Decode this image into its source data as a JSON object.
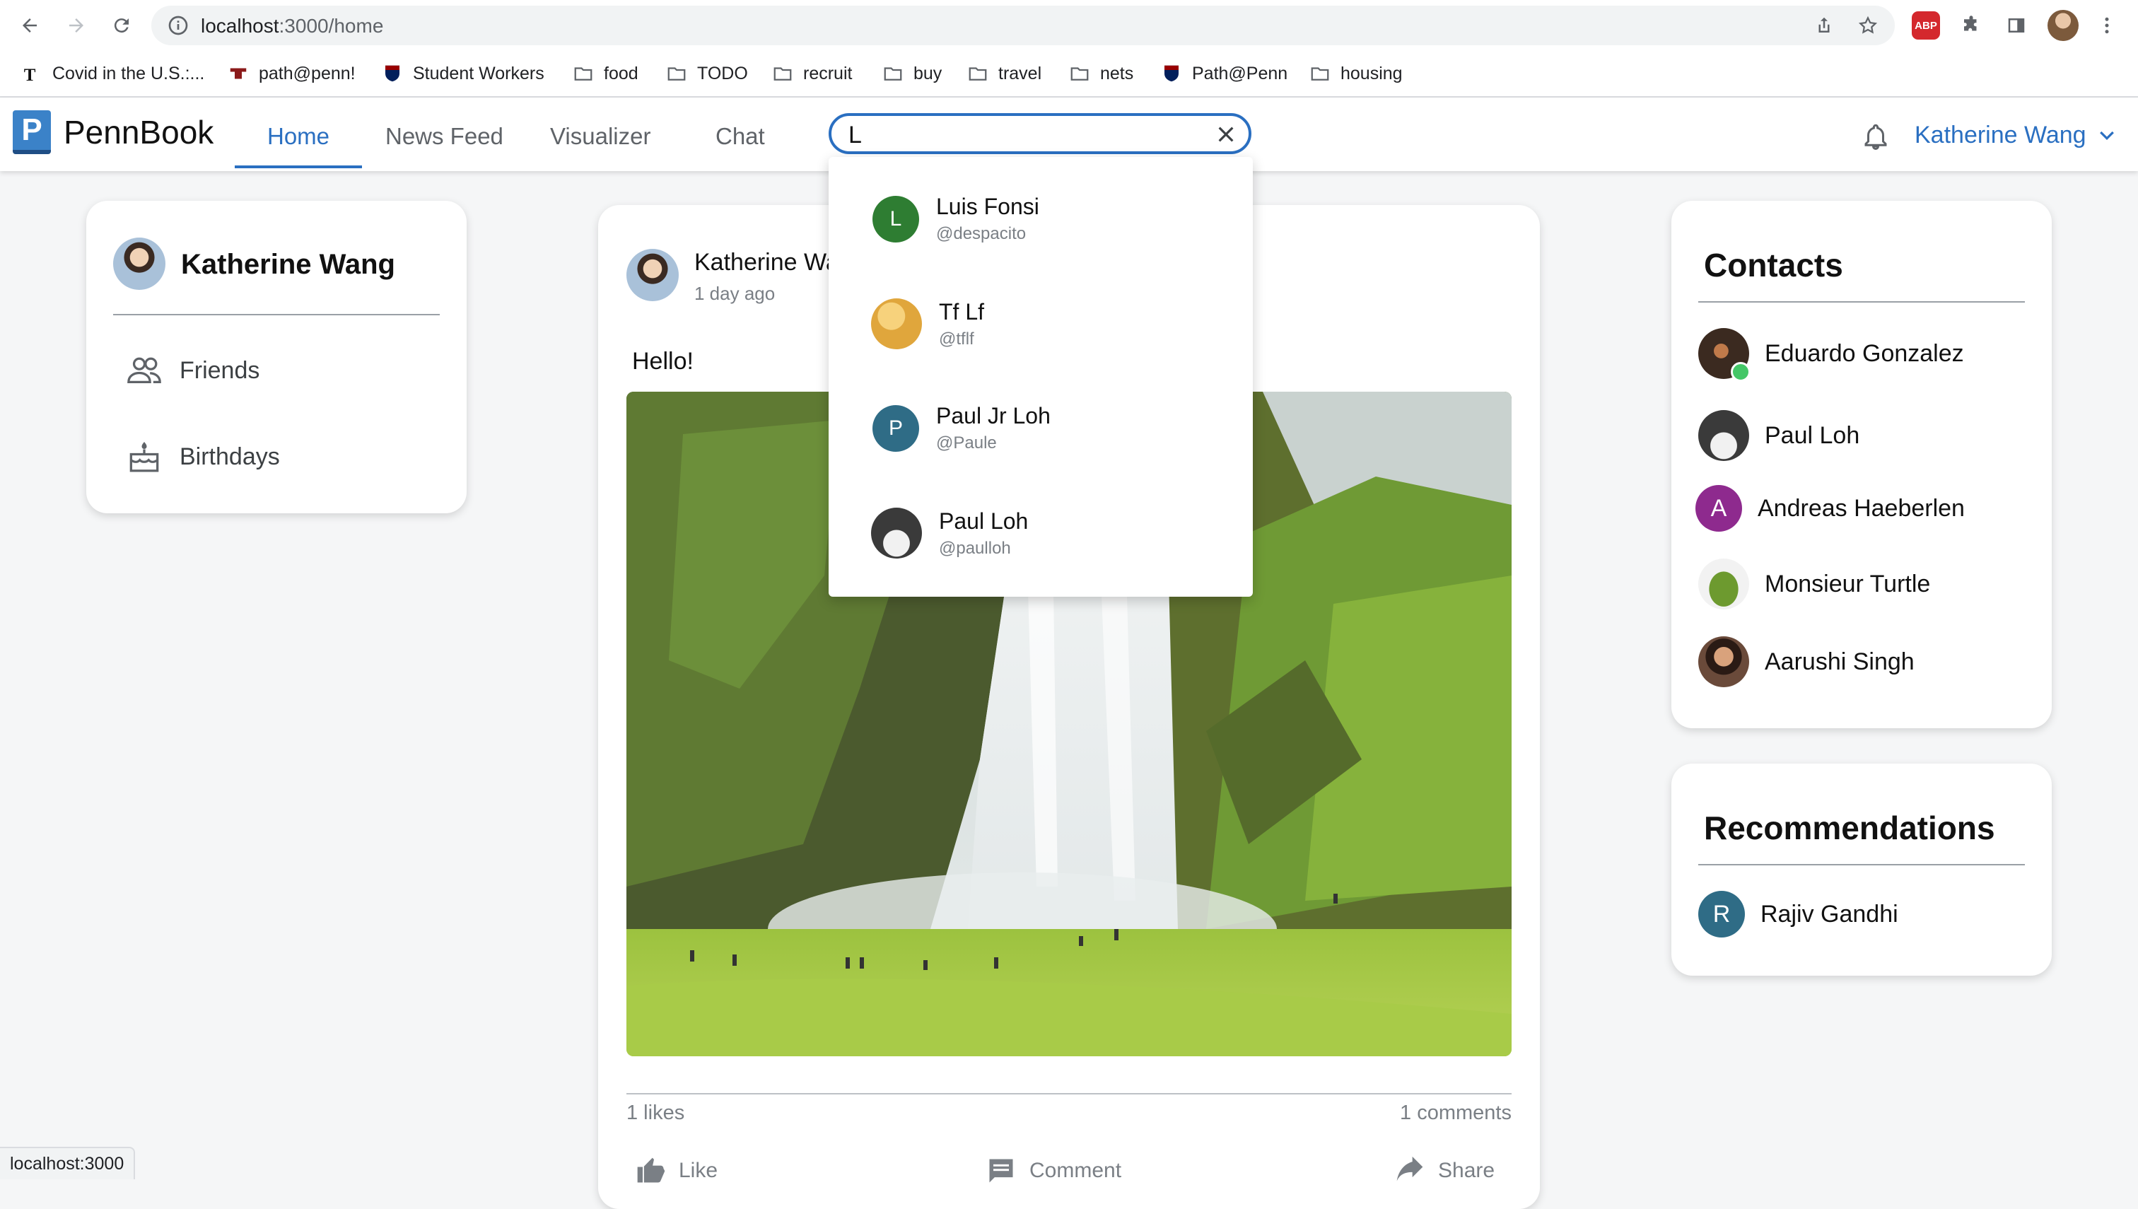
{
  "browser": {
    "url_host": "localhost",
    "url_path": ":3000/home",
    "status_url": "localhost:3000",
    "bookmarks": [
      {
        "label": "Covid in the U.S.:...",
        "icon": "nyt-icon"
      },
      {
        "label": "path@penn!",
        "icon": "penn-icon"
      },
      {
        "label": "Student Workers",
        "icon": "penn-shield-icon"
      },
      {
        "label": "food",
        "icon": "folder-icon"
      },
      {
        "label": "TODO",
        "icon": "folder-icon"
      },
      {
        "label": "recruit",
        "icon": "folder-icon"
      },
      {
        "label": "buy",
        "icon": "folder-icon"
      },
      {
        "label": "travel",
        "icon": "folder-icon"
      },
      {
        "label": "nets",
        "icon": "folder-icon"
      },
      {
        "label": "Path@Penn",
        "icon": "penn-shield-icon"
      },
      {
        "label": "housing",
        "icon": "folder-icon"
      }
    ],
    "adblock_label": "ABP"
  },
  "app": {
    "logo_letter": "P",
    "logo_text": "PennBook",
    "tabs": [
      {
        "label": "Home",
        "active": true
      },
      {
        "label": "News Feed",
        "active": false
      },
      {
        "label": "Visualizer",
        "active": false
      },
      {
        "label": "Chat",
        "active": false
      }
    ],
    "search": {
      "value": "L",
      "placeholder": ""
    },
    "user_name": "Katherine Wang",
    "accent_color": "#2a6fc1"
  },
  "search_results": [
    {
      "name": "Luis Fonsi",
      "handle": "@despacito",
      "initial": "L",
      "avatar_color": "#2e7d32"
    },
    {
      "name": "Tf Lf",
      "handle": "@tflf",
      "initial": "",
      "avatar_color": "#e8b54a"
    },
    {
      "name": "Paul Jr Loh",
      "handle": "@Paule",
      "initial": "P",
      "avatar_color": "#2f6c86"
    },
    {
      "name": "Paul Loh",
      "handle": "@paulloh",
      "initial": "",
      "avatar_color": "#3a3a3a"
    }
  ],
  "left_panel": {
    "name": "Katherine Wang",
    "items": [
      {
        "label": "Friends",
        "icon": "friends-icon"
      },
      {
        "label": "Birthdays",
        "icon": "cake-icon"
      }
    ]
  },
  "post": {
    "author": "Katherine Wang",
    "time": "1 day ago",
    "text": "Hello!",
    "likes": "1 likes",
    "comments": "1 comments",
    "actions": [
      "Like",
      "Comment",
      "Share"
    ]
  },
  "contacts": {
    "title": "Contacts",
    "items": [
      {
        "name": "Eduardo Gonzalez",
        "initial": "",
        "avatar_color": "#3b2a20",
        "online": true
      },
      {
        "name": "Paul Loh",
        "initial": "",
        "avatar_color": "#3a3a3a",
        "online": false
      },
      {
        "name": "Andreas Haeberlen",
        "initial": "A",
        "avatar_color": "#8e2a8e",
        "online": false
      },
      {
        "name": "Monsieur Turtle",
        "initial": "",
        "avatar_color": "#8db04a",
        "online": false
      },
      {
        "name": "Aarushi Singh",
        "initial": "",
        "avatar_color": "#5a3a2a",
        "online": false
      }
    ]
  },
  "recommendations": {
    "title": "Recommendations",
    "items": [
      {
        "name": "Rajiv Gandhi",
        "initial": "R",
        "avatar_color": "#2f6c86"
      }
    ]
  }
}
